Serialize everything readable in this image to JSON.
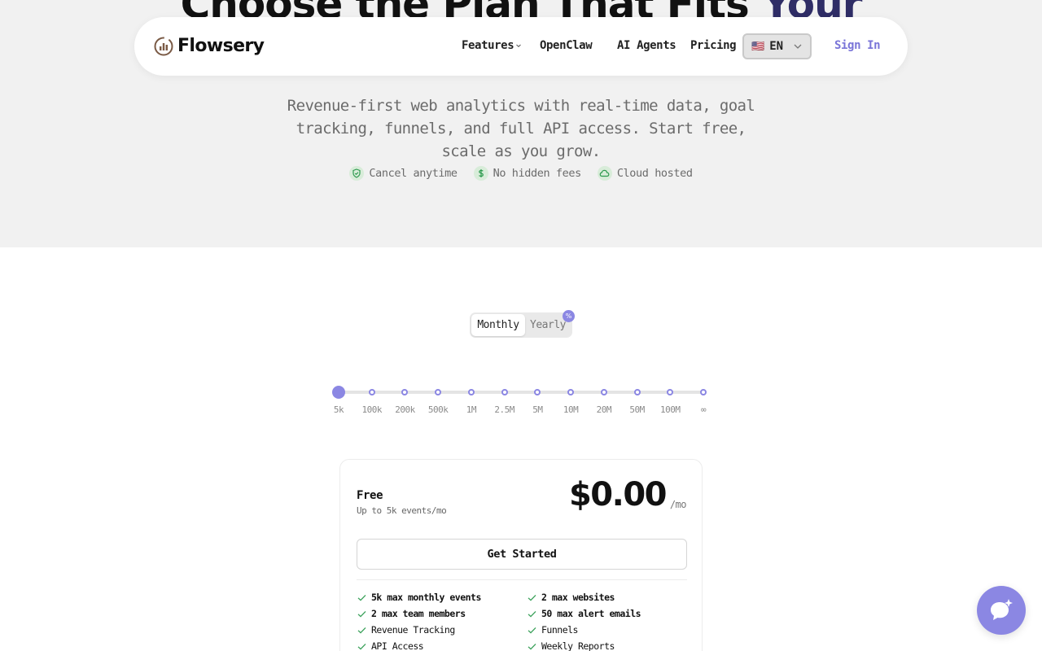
{
  "hero": {
    "title": "Choose the Plan That Fits ",
    "title_accent": "Your",
    "subtitle": "Revenue-first web analytics with real-time data, goal tracking, funnels, and full API access. Start free, scale as you grow.",
    "badges": [
      {
        "label": "Cancel anytime",
        "icon": "shield-check-icon"
      },
      {
        "label": "No hidden fees",
        "icon": "dollar-icon"
      },
      {
        "label": "Cloud hosted",
        "icon": "cloud-icon"
      }
    ]
  },
  "nav": {
    "brand": "Flowsery",
    "items": [
      "Features",
      "OpenClaw",
      "AI Agents",
      "Pricing"
    ],
    "language": {
      "flag": "🇺🇸",
      "code": "EN"
    },
    "sign_in": "Sign In"
  },
  "billing": {
    "monthly": "Monthly",
    "yearly": "Yearly",
    "discount_icon": "%",
    "selected": "Monthly"
  },
  "slider": {
    "ticks": [
      "5k",
      "100k",
      "200k",
      "500k",
      "1M",
      "2.5M",
      "5M",
      "10M",
      "20M",
      "50M",
      "100M",
      "∞"
    ],
    "selected_index": 0
  },
  "plan": {
    "name": "Free",
    "subtitle": "Up to 5k events/mo",
    "price": "$0.00",
    "period": "/mo",
    "cta": "Get Started",
    "features": [
      {
        "label": "5k max monthly events",
        "strong": true
      },
      {
        "label": "2 max websites",
        "strong": true
      },
      {
        "label": "2 max team members",
        "strong": true
      },
      {
        "label": "50 max alert emails",
        "strong": true
      },
      {
        "label": "Revenue Tracking",
        "strong": false
      },
      {
        "label": "Funnels",
        "strong": false
      },
      {
        "label": "API Access",
        "strong": false
      },
      {
        "label": "Weekly Reports",
        "strong": false
      }
    ]
  },
  "colors": {
    "accent": "#8b87e3",
    "hero_bg": "#f1f1f1",
    "check": "#3aa15a"
  }
}
